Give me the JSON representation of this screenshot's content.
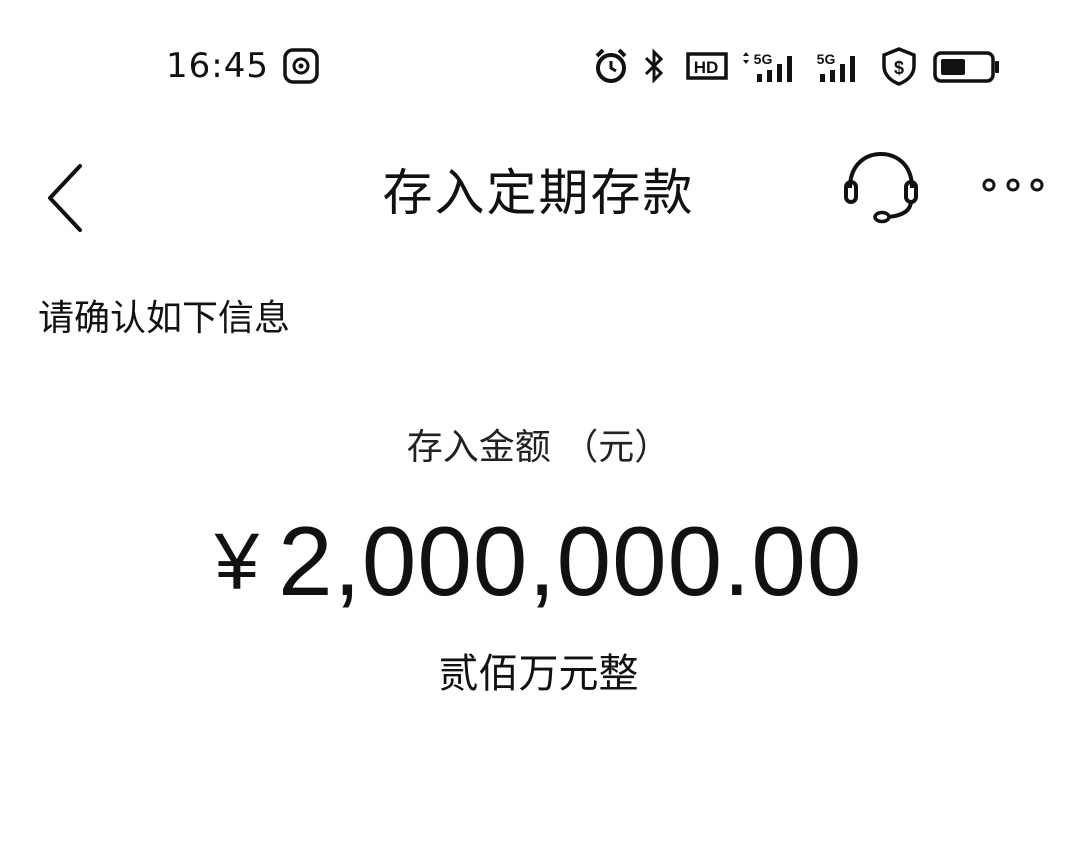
{
  "status_bar": {
    "time": "16:45",
    "icons": [
      "screen-record-icon",
      "alarm-icon",
      "bluetooth-icon",
      "hd-voice-icon",
      "signal-5g-icon",
      "signal-5g-icon",
      "security-shield-icon",
      "battery-icon"
    ],
    "hd_label": "HD",
    "network_label": "5G"
  },
  "nav": {
    "title": "存入定期存款",
    "back_icon": "chevron-left-icon",
    "service_icon": "headset-icon",
    "more_icon": "more-horizontal-icon"
  },
  "content": {
    "confirm_hint": "请确认如下信息",
    "amount_label": "存入金额 （元）",
    "currency_symbol": "¥",
    "amount": "2,000,000.00",
    "amount_in_words": "贰佰万元整"
  },
  "colors": {
    "text": "#111111",
    "background": "#ffffff"
  }
}
